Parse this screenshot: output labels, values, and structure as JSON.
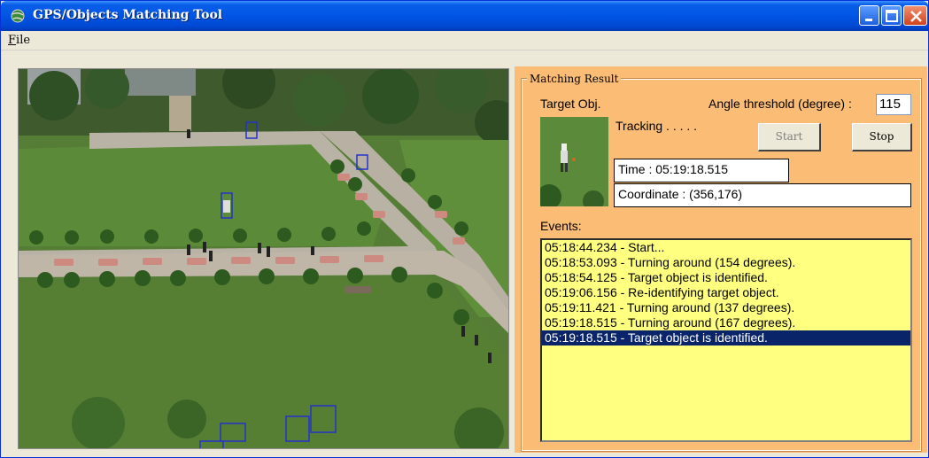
{
  "window": {
    "title": "GPS/Objects Matching Tool",
    "title_color": "#ffffff",
    "controls": [
      "minimize-icon",
      "maximize-icon",
      "close-icon"
    ]
  },
  "menu": {
    "file_label": "File"
  },
  "camera_view": {
    "description_icon": "camera-feed",
    "detection_box_color": "#2233cc"
  },
  "matching": {
    "group_title": "Matching Result",
    "target_label": "Target Obj.",
    "angle_label": "Angle threshold (degree) :",
    "angle_value": "115",
    "status": "Tracking . . . . .",
    "start_label": "Start",
    "stop_label": "Stop",
    "time_text": "Time : 05:19:18.515",
    "coordinate_text": "Coordinate :  (356,176)",
    "panel_color": "#fbbd75"
  },
  "events": {
    "label": "Events:",
    "items": [
      "05:18:44.234 - Start...",
      "05:18:53.093 - Turning around (154 degrees).",
      "05:18:54.125 - Target object is identified.",
      "05:19:06.156 - Re-identifying target object.",
      "05:19:11.421 - Turning around (137 degrees).",
      "05:19:18.515 - Turning around (167 degrees).",
      "05:19:18.515 - Target object is identified."
    ],
    "selected_index": 6,
    "list_color": "#ffff80",
    "selection_color": "#0a246a"
  }
}
